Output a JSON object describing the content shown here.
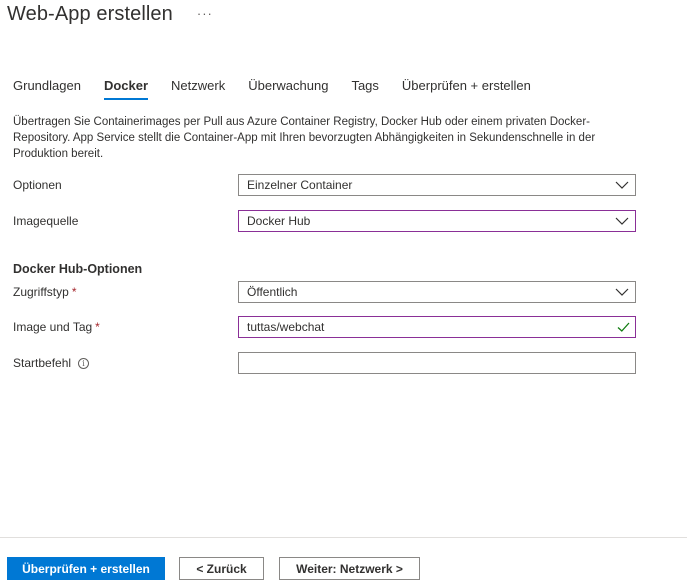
{
  "header": {
    "title": "Web-App erstellen",
    "more_label": "···"
  },
  "tabs": [
    {
      "label": "Grundlagen",
      "active": false
    },
    {
      "label": "Docker",
      "active": true
    },
    {
      "label": "Netzwerk",
      "active": false
    },
    {
      "label": "Überwachung",
      "active": false
    },
    {
      "label": "Tags",
      "active": false
    },
    {
      "label": "Überprüfen + erstellen",
      "active": false
    }
  ],
  "description": "Übertragen Sie Containerimages per Pull aus Azure Container Registry, Docker Hub oder einem privaten Docker-Repository. App Service stellt die Container-App mit Ihren bevorzugten Abhängigkeiten in Sekundenschnelle in der Produktion bereit.",
  "form": {
    "options": {
      "label": "Optionen",
      "value": "Einzelner Container"
    },
    "image_source": {
      "label": "Imagequelle",
      "value": "Docker Hub"
    },
    "section_heading": "Docker Hub-Optionen",
    "access_type": {
      "label": "Zugriffstyp",
      "required_mark": "*",
      "value": "Öffentlich"
    },
    "image_tag": {
      "label": "Image und Tag",
      "required_mark": "*",
      "value": "tuttas/webchat"
    },
    "start_command": {
      "label": "Startbefehl",
      "info_glyph": "i",
      "value": ""
    }
  },
  "footer": {
    "review_create": "Überprüfen + erstellen",
    "back": "< Zurück",
    "next": "Weiter: Netzwerk >"
  },
  "colors": {
    "accent": "#0078d4",
    "focus_border": "#8a2f97",
    "valid_check": "#107c10",
    "required": "#a4262c"
  }
}
